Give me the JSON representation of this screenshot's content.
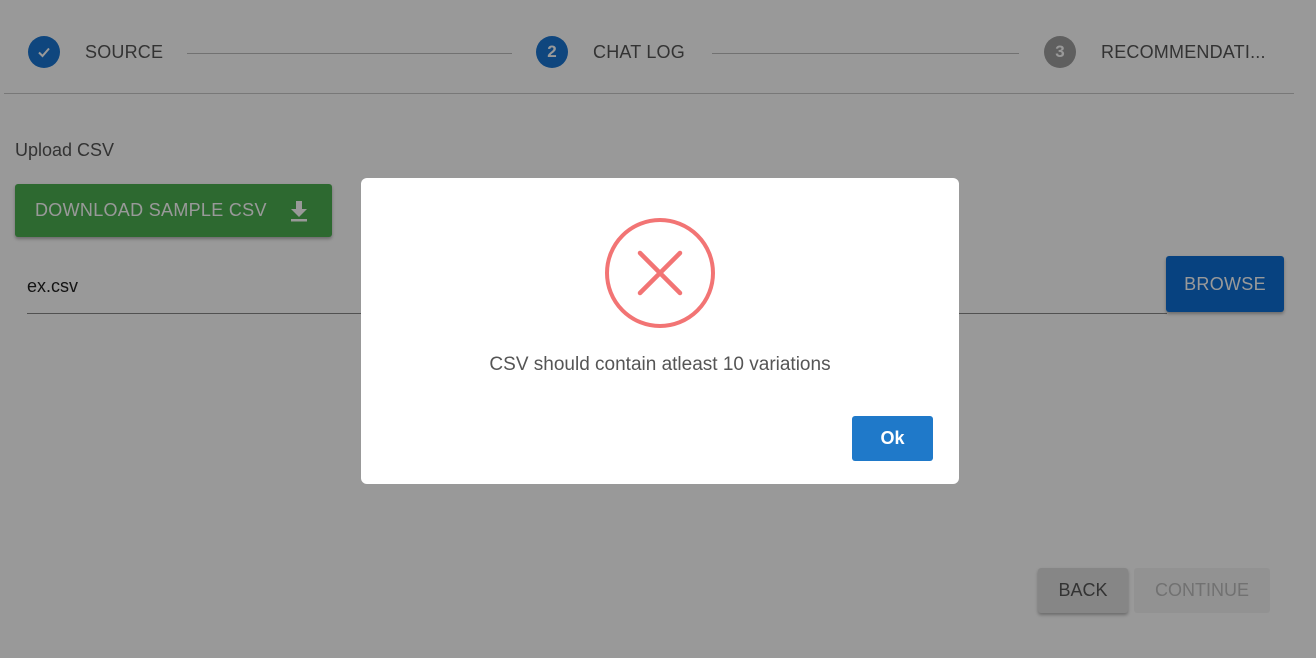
{
  "stepper": {
    "steps": [
      {
        "label": "SOURCE",
        "number": "",
        "state": "completed"
      },
      {
        "label": "CHAT LOG",
        "number": "2",
        "state": "active"
      },
      {
        "label": "RECOMMENDATI...",
        "number": "3",
        "state": "inactive"
      }
    ]
  },
  "upload": {
    "label": "Upload CSV",
    "download_button": "DOWNLOAD SAMPLE CSV",
    "file_value": "ex.csv",
    "browse_button": "BROWSE"
  },
  "footer": {
    "back_button": "BACK",
    "continue_button": "CONTINUE"
  },
  "dialog": {
    "message": "CSV should contain atleast 10 variations",
    "ok_button": "Ok",
    "icon": "error-x-icon"
  },
  "colors": {
    "primary": "#1976d2",
    "success": "#4caf50",
    "error": "#f27474",
    "dialog_button": "#1f79c9"
  }
}
